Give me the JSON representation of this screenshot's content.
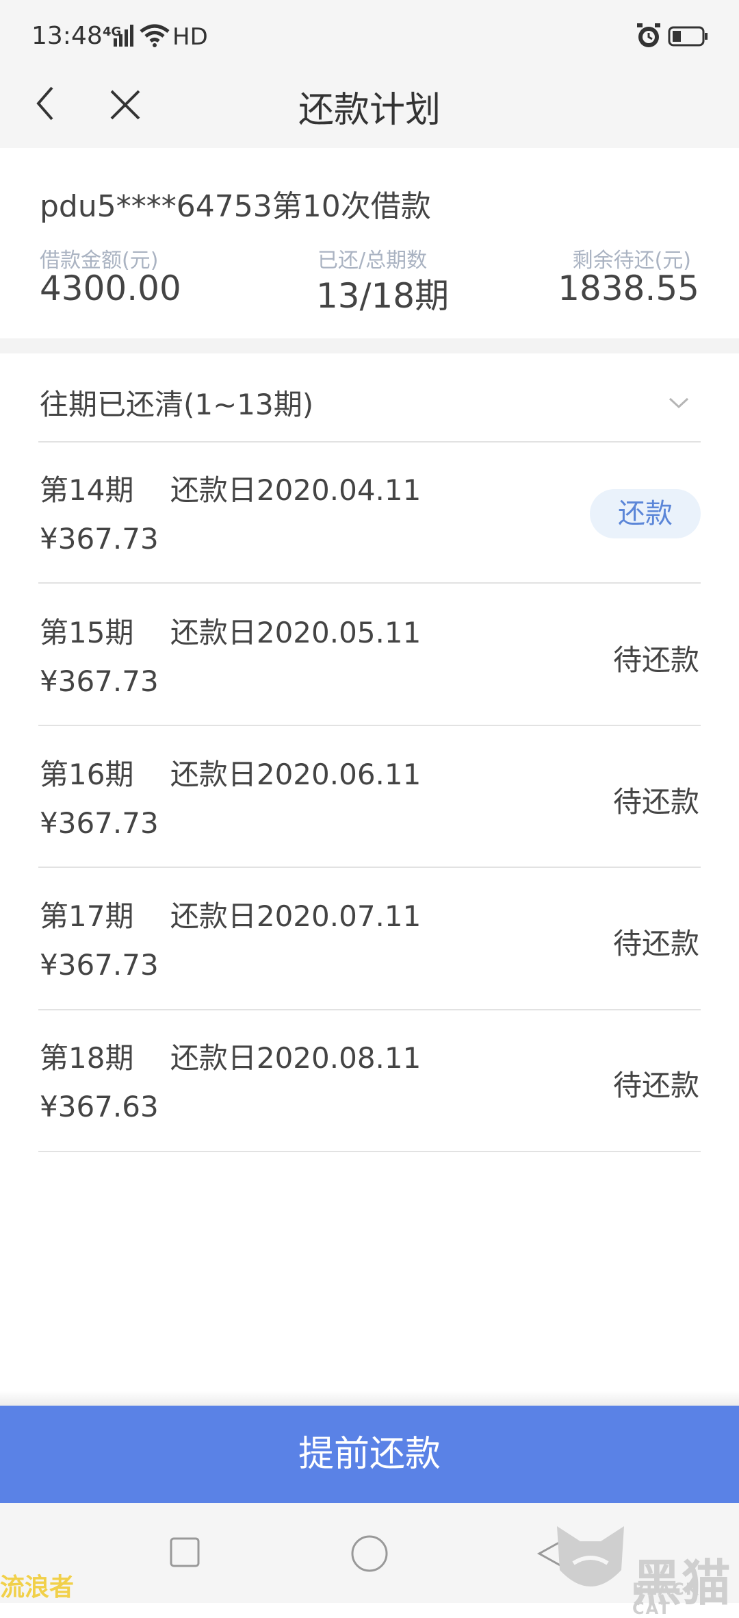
{
  "status_bar": {
    "time": "13:48",
    "network": "4G",
    "hd": "HD"
  },
  "nav": {
    "title": "还款计划",
    "back_icon": "chevron-left-icon",
    "close_icon": "close-icon"
  },
  "loan": {
    "title": "pdu5****64753第10次借款",
    "amount_label": "借款金额(元)",
    "amount_value": "4300.00",
    "periods_label": "已还/总期数",
    "periods_value": "13/18期",
    "remaining_label": "剩余待还(元)",
    "remaining_value": "1838.55"
  },
  "history": {
    "label": "往期已还清(1~13期)"
  },
  "installments": [
    {
      "period": "第14期",
      "due": "还款日2020.04.11",
      "amount": "¥367.73",
      "action": "还款"
    },
    {
      "period": "第15期",
      "due": "还款日2020.05.11",
      "amount": "¥367.73",
      "status": "待还款"
    },
    {
      "period": "第16期",
      "due": "还款日2020.06.11",
      "amount": "¥367.73",
      "status": "待还款"
    },
    {
      "period": "第17期",
      "due": "还款日2020.07.11",
      "amount": "¥367.73",
      "status": "待还款"
    },
    {
      "period": "第18期",
      "due": "还款日2020.08.11",
      "amount": "¥367.63",
      "status": "待还款"
    }
  ],
  "footer": {
    "prepay_label": "提前还款"
  },
  "watermark": {
    "left": "流浪者",
    "right_cn": "黑猫",
    "right_en": "BLACK CAT"
  },
  "colors": {
    "accent": "#5a82e6",
    "pay_badge_bg": "#eaf2fb",
    "pay_badge_text": "#5b86d8"
  }
}
